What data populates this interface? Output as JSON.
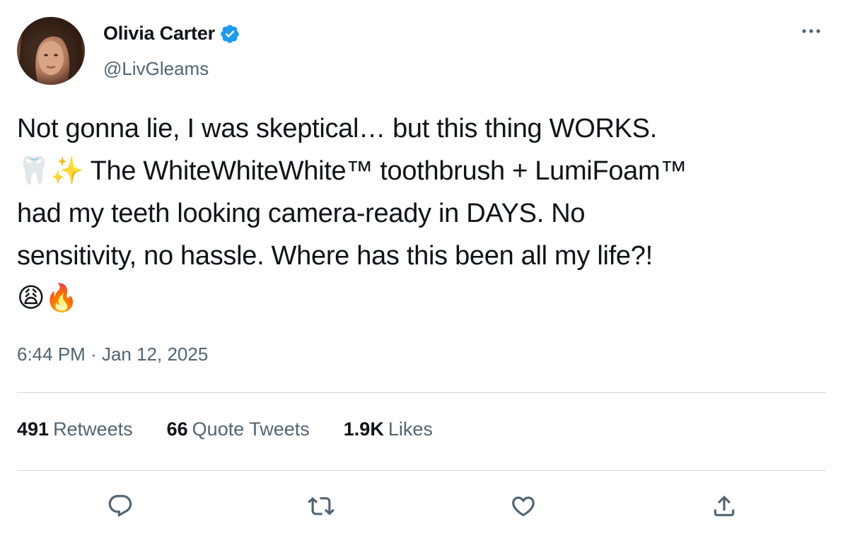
{
  "author": {
    "display_name": "Olivia Carter",
    "handle": "@LivGleams",
    "verified": true
  },
  "tweet": {
    "lines": [
      "Not gonna lie, I was skeptical… but this thing WORKS.",
      "🦷✨ The WhiteWhiteWhite™ toothbrush + LumiFoam™",
      "had my teeth looking camera-ready in DAYS. No",
      "sensitivity, no hassle. Where has this been all my life?!",
      "😩🔥"
    ]
  },
  "timestamp": {
    "time": "6:44 PM",
    "separator": " · ",
    "date": "Jan 12, 2025"
  },
  "stats": {
    "retweets_count": "491",
    "retweets_label": "Retweets",
    "quotes_count": "66",
    "quotes_label": "Quote Tweets",
    "likes_count": "1.9K",
    "likes_label": "Likes"
  },
  "actions": {
    "reply_icon": "reply-icon",
    "retweet_icon": "retweet-icon",
    "like_icon": "heart-icon",
    "share_icon": "share-icon"
  },
  "colors": {
    "text_primary": "#0f1419",
    "text_secondary": "#536471",
    "verified_blue": "#1d9bf0",
    "divider": "#cfd9de"
  }
}
